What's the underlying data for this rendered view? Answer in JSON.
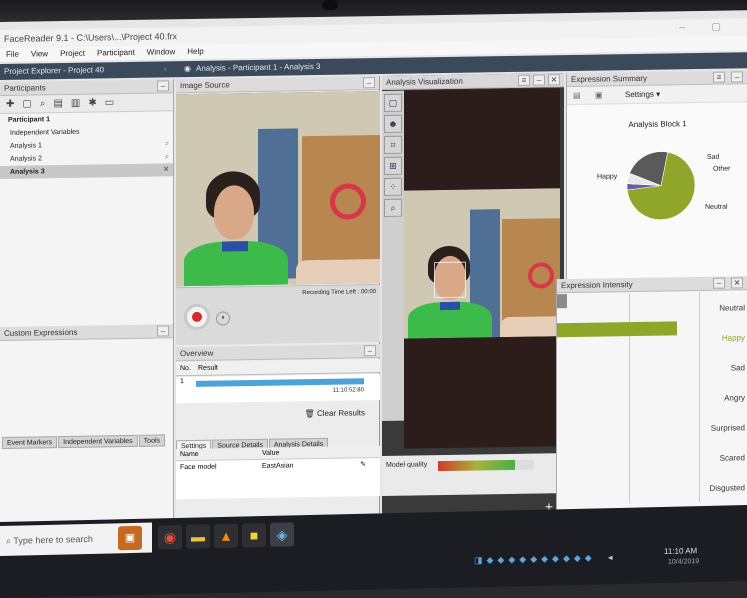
{
  "window": {
    "title": "FaceReader 9.1 - C:\\Users\\...\\Project 40.frx",
    "controls": "– ▢"
  },
  "menu": [
    "File",
    "View",
    "Project",
    "Participant",
    "Window",
    "Help"
  ],
  "docbar": {
    "left": "Project Explorer - Project 40",
    "title": "Analysis - Participant 1 - Analysis 3"
  },
  "explorer": {
    "section": "Participants",
    "participant": "Participant 1",
    "independent_variables": "Independent Variables",
    "analyses": [
      "Analysis 1",
      "Analysis 2",
      "Analysis 3"
    ],
    "expressions": "Custom Expressions",
    "bottom_tabs": [
      "Event Markers",
      "Independent Variables",
      "Tools"
    ]
  },
  "image_source": {
    "title": "Image Source",
    "recording_time": "Recording Time Left : 00:00",
    "overview_title": "Overview",
    "table_headers": [
      "No.",
      "Result"
    ],
    "row_no": "1",
    "row_time": "11:10:52:80",
    "progress": 1.0,
    "clear_results": "Clear Results",
    "settings_tabs": [
      "Settings",
      "Source Details",
      "Analysis Details"
    ],
    "settings_headers": [
      "Name",
      "Value"
    ],
    "settings_row": {
      "name": "Face model",
      "value": "EastAsian"
    }
  },
  "analysis_viz": {
    "title": "Analysis Visualization",
    "model_quality_label": "Model quality",
    "model_quality": 0.8
  },
  "expression_summary": {
    "title": "Expression Summary",
    "settings_label": "Settings",
    "chart_title": "Analysis Block 1",
    "slices": [
      {
        "label": "Happy",
        "value": 0.7,
        "color": "#8fa62a"
      },
      {
        "label": "Sad",
        "value": 0.03,
        "color": "#6e5aa6"
      },
      {
        "label": "Other",
        "value": 0.05,
        "color": "#e8e8e8"
      },
      {
        "label": "Neutral",
        "value": 0.22,
        "color": "#5a5a5a"
      }
    ]
  },
  "expression_intensity": {
    "title": "Expression Intensity",
    "labels": [
      "Neutral",
      "Happy",
      "Sad",
      "Angry",
      "Surprised",
      "Scared",
      "Disgusted"
    ],
    "happy_color": "#8fa62a"
  },
  "taskbar": {
    "search_placeholder": "Type here to search",
    "time": "11:10 AM",
    "date": "10/4/2019"
  }
}
